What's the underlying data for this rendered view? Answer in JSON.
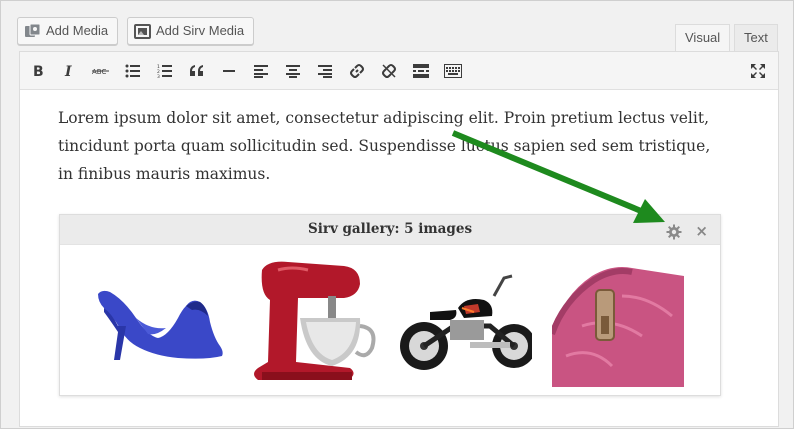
{
  "media_buttons": {
    "add_media": "Add Media",
    "add_sirv_media": "Add Sirv Media"
  },
  "tabs": {
    "visual": "Visual",
    "text": "Text",
    "active": "Visual"
  },
  "toolbar": {
    "buttons": [
      "bold",
      "italic",
      "strikethrough",
      "bulleted-list",
      "numbered-list",
      "blockquote",
      "horizontal-line",
      "align-left",
      "align-center",
      "align-right",
      "insert-link",
      "remove-link",
      "read-more",
      "toolbar-toggle",
      "fullscreen"
    ]
  },
  "content": {
    "paragraph": "Lorem ipsum dolor sit amet, consectetur adipiscing elit. Proin pretium lectus velit, tincidunt porta quam sollicitudin sed. Suspendisse luctus sapien sed sem tristique, in finibus mauris maximus."
  },
  "gallery": {
    "title": "Sirv gallery: 5 images",
    "images": [
      "blue high-heel shoe",
      "red stand mixer",
      "motorcycle",
      "pink leather purse"
    ]
  },
  "colors": {
    "arrow": "#1e8a1e",
    "shoe": "#3646c8",
    "mixer": "#b01825",
    "purse": "#cc5a86"
  }
}
